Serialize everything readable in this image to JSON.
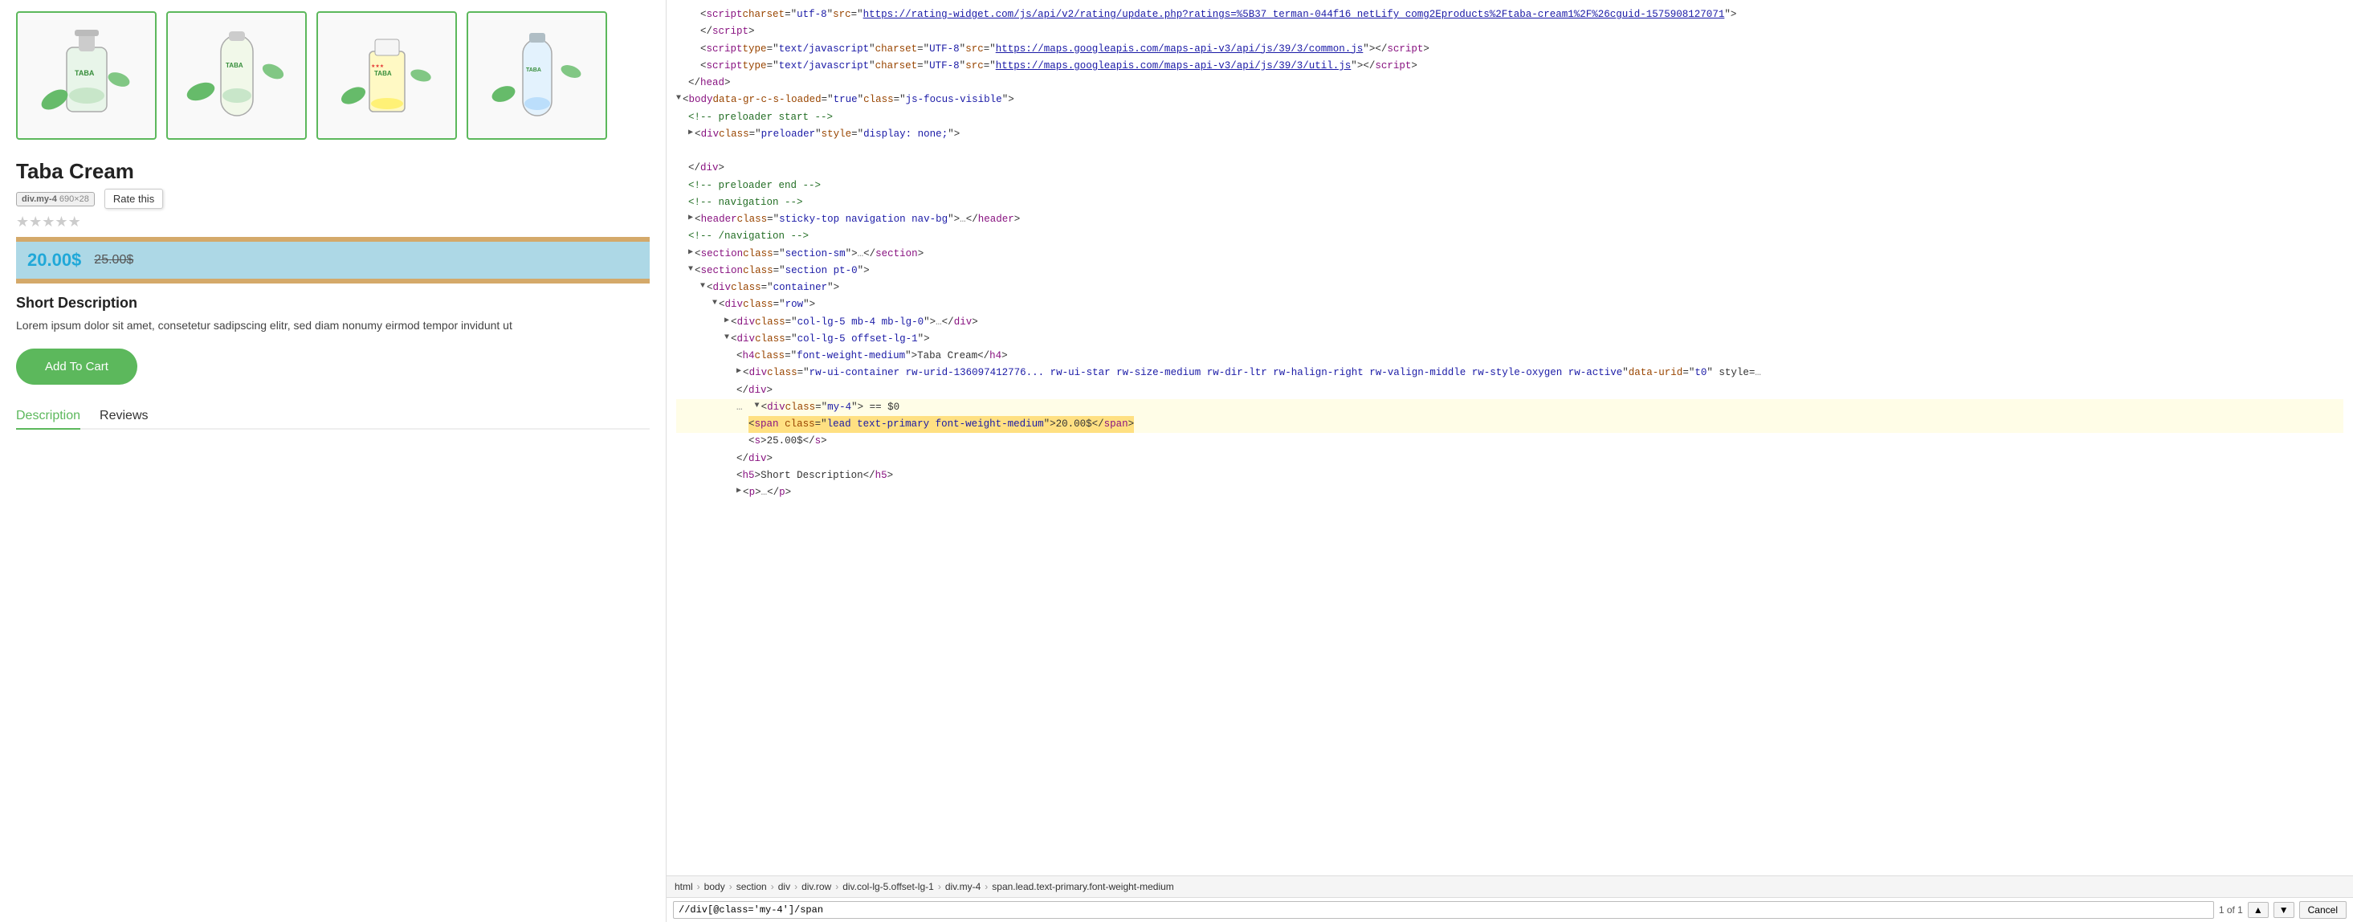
{
  "leftPanel": {
    "productImages": [
      {
        "alt": "Taba Cream bottle with pump",
        "id": "img1"
      },
      {
        "alt": "Taba Cream tall bottle",
        "id": "img2"
      },
      {
        "alt": "Taba Cream tube",
        "id": "img3"
      },
      {
        "alt": "Taba Cream spray bottle",
        "id": "img4"
      }
    ],
    "productTitle": "Taba Cream",
    "devToolsTag": {
      "name": "div.my-4",
      "dimensions": "690×28"
    },
    "rateThisLabel": "Rate this",
    "priceSection": {
      "salePrice": "20.00$",
      "originalPrice": "25.00$"
    },
    "shortDescription": {
      "title": "Short Description",
      "text": "Lorem ipsum dolor sit amet, consetetur sadipscing elitr, sed diam nonumy eirmod tempor invidunt ut"
    },
    "addToCartLabel": "Add To Cart",
    "tabs": [
      {
        "label": "Description",
        "active": true
      },
      {
        "label": "Reviews",
        "active": false
      }
    ]
  },
  "devTools": {
    "urlInScript": "https://rating-widget.com/js/api/v2/rating/update.php?ratings=%5B37_terman-044f16_netLify_comg2Eproducts%2Ftaba-cream1%2F%26cguid-1575908127071",
    "googleMapsUrl1": "https://maps.googleapis.com/maps-api-v3/api/js/39/3/common.js",
    "googleMapsUrl2": "https://maps.googleapis.com/maps-api-v3/api/js/39/3/util.js",
    "breadcrumb": [
      "html",
      "body",
      "section",
      "div",
      "div.row",
      "div.col-lg-5.offset-lg-1",
      "div.my-4",
      "span.lead.text-primary.font-weight-medium"
    ],
    "xpathValue": "//div[@class='my-4']/span",
    "xpathCount": "1 of 1",
    "cancelLabel": "Cancel"
  }
}
